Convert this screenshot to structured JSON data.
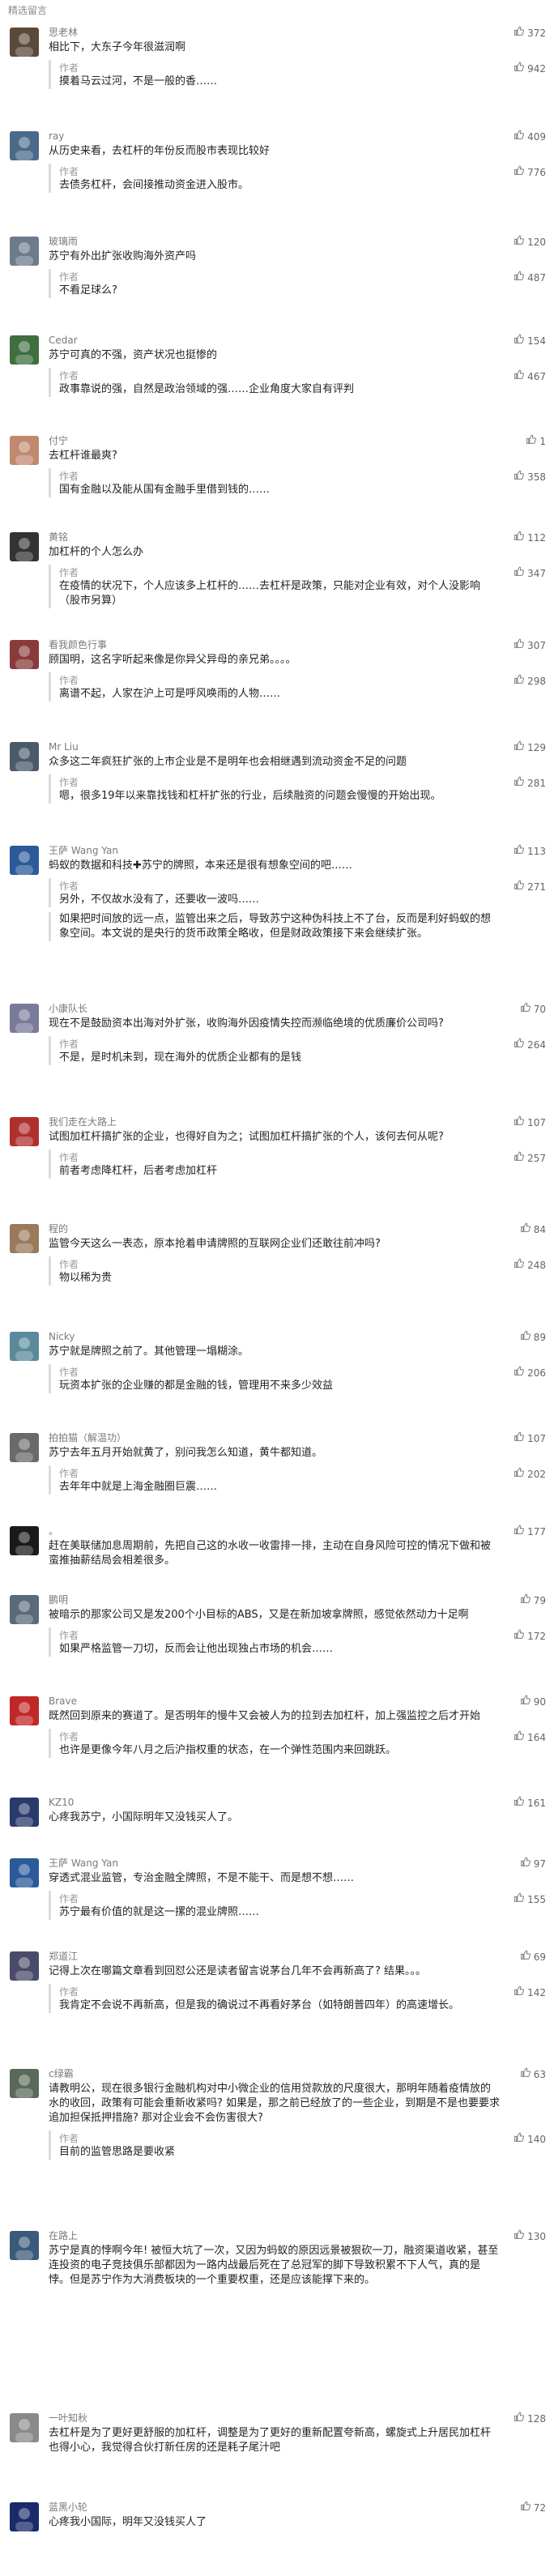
{
  "section_title": "精选留言",
  "reply_label": "作者",
  "comments": [
    {
      "name": "思老林",
      "likes": "372",
      "content": "相比下，大东子今年很滋润啊",
      "reply": "摸着马云过河，不是一般的香……",
      "reply_likes": "942",
      "avatar_color": "#5a4a3a"
    },
    {
      "name": "ray",
      "likes": "409",
      "content": "从历史来看，去杠杆的年份反而股市表现比较好",
      "reply": "去债务杠杆，会间接推动资金进入股市。",
      "reply_likes": "776",
      "avatar_color": "#4a6a8a"
    },
    {
      "name": "玻璃雨",
      "likes": "120",
      "content": "苏宁有外出扩张收购海外资产吗",
      "reply": "不看足球么?",
      "reply_likes": "487",
      "avatar_color": "#6c7c8c"
    },
    {
      "name": "Cedar",
      "likes": "154",
      "content": "苏宁可真的不强，资产状况也挺惨的",
      "reply": "政事靠说的强，自然是政治领域的强……企业角度大家自有评判",
      "reply_likes": "467",
      "avatar_color": "#3f6f3f"
    },
    {
      "name": "付宁",
      "likes": "1",
      "content": "去杠杆谁最爽?",
      "reply": "国有金融以及能从国有金融手里借到钱的……",
      "reply_likes": "358",
      "avatar_color": "#c08a70"
    },
    {
      "name": "黄铭",
      "likes": "112",
      "content": "加杠杆的个人怎么办",
      "reply": "在疫情的状况下，个人应该多上杠杆的……去杠杆是政策，只能对企业有效，对个人没影响（股市另算）",
      "reply_likes": "347",
      "avatar_color": "#333333"
    },
    {
      "name": "看我颜色行事",
      "likes": "307",
      "content": "顾国明，这名字听起来像是你异父异母的亲兄弟。。。。",
      "reply": "离谱不起，人家在沪上可是呼风唤雨的人物……",
      "reply_likes": "298",
      "avatar_color": "#8a3a3a"
    },
    {
      "name": "Mr Liu",
      "likes": "129",
      "content": "众多这二年疯狂扩张的上市企业是不是明年也会相继遇到流动资金不足的问题",
      "reply": "嗯，很多19年以来靠找钱和杠杆扩张的行业，后续融资的问题会慢慢的开始出现。",
      "reply_likes": "281",
      "avatar_color": "#4a5a6a"
    },
    {
      "name": "王萨 Wang Yan",
      "likes": "113",
      "content": "蚂蚁的数据和科技✚苏宁的牌照，本来还是很有想象空间的吧……",
      "reply": "另外，不仅故水没有了，还要收一波吗……",
      "reply_likes": "271",
      "avatar_color": "#2a5a9a"
    },
    {
      "name": "",
      "likes": "",
      "content": "",
      "reply": "如果把时间放的远一点，监管出来之后，导致苏宁这种伪科技上不了台，反而是利好蚂蚁的想象空间。本文说的是央行的货币政策全略收，但是财政政策接下来会继续扩张。",
      "reply_likes": "",
      "avatar_color": ""
    },
    {
      "name": "小康队长",
      "likes": "70",
      "content": "现在不是鼓励资本出海对外扩张，收购海外因疫情失控而濒临绝境的优质廉价公司吗?",
      "reply": "不是，是时机未到，现在海外的优质企业都有的是钱",
      "reply_likes": "264",
      "avatar_color": "#7a7a9a"
    },
    {
      "name": "我们走在大路上",
      "likes": "107",
      "content": "试图加杠杆搞扩张的企业，也得好自为之；试图加杠杆搞扩张的个人，该何去何从呢?",
      "reply": "前者考虑降杠杆，后者考虑加杠杆",
      "reply_likes": "257",
      "avatar_color": "#b03030"
    },
    {
      "name": "程的",
      "likes": "84",
      "content": "监管今天这么一表态，原本抢着申请牌照的互联网企业们还敢往前冲吗?",
      "reply": "物以稀为贵",
      "reply_likes": "248",
      "avatar_color": "#9a7a5a"
    },
    {
      "name": "Nicky",
      "likes": "89",
      "content": "苏宁就是牌照之前了。其他管理一塌糊涂。",
      "reply": "玩资本扩张的企业赚的都是金融的钱，管理用不来多少效益",
      "reply_likes": "206",
      "avatar_color": "#5a8a9a"
    },
    {
      "name": "拍拍猫（解温功）",
      "likes": "107",
      "content": "苏宁去年五月开始就黄了，别问我怎么知道，黄牛都知道。",
      "reply": "去年年中就是上海金融圈巨震……",
      "reply_likes": "202",
      "avatar_color": "#6a6a6a"
    },
    {
      "name": "。",
      "likes": "177",
      "content": "赶在美联储加息周期前，先把自己这的水收一收雷排一排，主动在自身风险可控的情况下做和被蛮推抽薪结局会相差很多。",
      "reply": "",
      "reply_likes": "",
      "avatar_color": "#1a1a1a"
    },
    {
      "name": "鹏明",
      "likes": "79",
      "content": "被暗示的那家公司又是发200个小目标的ABS，又是在新加坡拿牌照，感觉依然动力十足啊",
      "reply": "如果严格监管一刀切，反而会让他出现独占市场的机会……",
      "reply_likes": "172",
      "avatar_color": "#5a6a7a"
    },
    {
      "name": "Brave",
      "likes": "90",
      "content": "既然回到原来的赛道了。是否明年的慢牛又会被人为的拉到去加杠杆，加上强监控之后才开始",
      "reply": "也许是更像今年八月之后沪指权重的状态，在一个弹性范围内来回跳跃。",
      "reply_likes": "164",
      "avatar_color": "#c02828"
    },
    {
      "name": "KZ10",
      "likes": "161",
      "content": "心疼我苏宁，小国际明年又没钱买人了。",
      "reply": "",
      "reply_likes": "",
      "avatar_color": "#2a3a6a"
    },
    {
      "name": "王萨 Wang Yan",
      "likes": "97",
      "content": "穿透式混业监管，专治金融全牌照，不是不能干、而是想不想……",
      "reply": "苏宁最有价值的就是这一摞的混业牌照……",
      "reply_likes": "155",
      "avatar_color": "#2a5a9a"
    },
    {
      "name": "郑道江",
      "likes": "69",
      "content": "记得上次在哪篇文章看到回怼公还是读者留言说茅台几年不会再新高了? 结果。。。",
      "reply": "我肯定不会说不再新高，但是我的确说过不再看好茅台（如特朗普四年）的高速增长。",
      "reply_likes": "142",
      "avatar_color": "#4a4a6a"
    },
    {
      "name": "c绿霸",
      "likes": "63",
      "content": "请教明公，现在很多银行金融机构对中小微企业的信用贷款放的尺度很大，那明年随着疫情放的水的收回，政策有可能会重新收紧吗? 如果是，那之前已经放了的一些企业，到期是不是也要要求追加担保抵押措施? 那对企业会不会伤害很大?",
      "reply": "目前的监管思路是要收紧",
      "reply_likes": "140",
      "avatar_color": "#5a6a5a"
    },
    {
      "name": "在路上",
      "likes": "130",
      "content": "苏宁是真的悖啊今年! 被恒大坑了一次，又因为蚂蚁的原因远景被狠砍一刀，融资渠道收紧，甚至连投资的电子竞技俱乐部都因为一路内战最后死在了总冠军的脚下导致积累不下人气，真的是悖。但是苏宁作为大消费板块的一个重要权重，还是应该能撑下来的。",
      "reply": "",
      "reply_likes": "",
      "avatar_color": "#3a5a7a"
    },
    {
      "name": "一叶知秋",
      "likes": "128",
      "content": "去杠杆是为了更好更舒服的加杠杆，调整是为了更好的重新配置夸新高，螺旋式上升居民加杠杆也得小心，我觉得合伙打新任房的还是耗子尾汁吧",
      "reply": "",
      "reply_likes": "",
      "avatar_color": "#8a8a8a"
    },
    {
      "name": "蓝黑小轮",
      "likes": "72",
      "content": "心疼我小国际，明年又没钱买人了",
      "reply": "",
      "reply_likes": "",
      "avatar_color": "#1a2a6a"
    }
  ]
}
